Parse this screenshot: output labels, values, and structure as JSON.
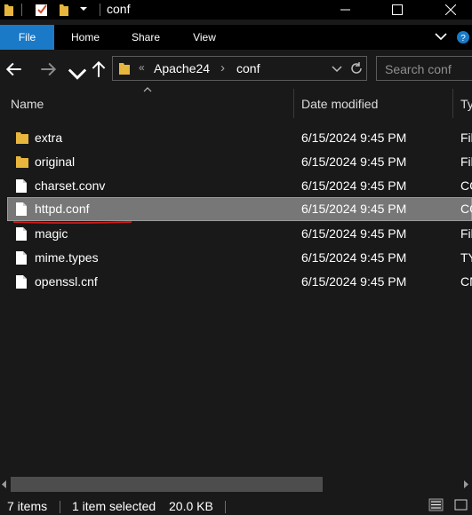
{
  "window": {
    "title": "conf",
    "controls": {
      "minimize": "minimize",
      "maximize": "maximize",
      "close": "close"
    }
  },
  "ribbon": {
    "tabs": [
      "File",
      "Home",
      "Share",
      "View"
    ],
    "accent": "#1a7ac7"
  },
  "address": {
    "overflow_glyph": "«",
    "crumbs": [
      "Apache24",
      "conf"
    ],
    "separator": "›"
  },
  "search": {
    "placeholder": "Search conf"
  },
  "columns": {
    "name": "Name",
    "date": "Date modified",
    "type": "Ty"
  },
  "files": [
    {
      "icon": "folder-icon",
      "name": "extra",
      "date": "6/15/2024 9:45 PM",
      "type": "Fil",
      "selected": false
    },
    {
      "icon": "folder-icon",
      "name": "original",
      "date": "6/15/2024 9:45 PM",
      "type": "Fil",
      "selected": false
    },
    {
      "icon": "file-icon",
      "name": "charset.conv",
      "date": "6/15/2024 9:45 PM",
      "type": "CC",
      "selected": false
    },
    {
      "icon": "file-icon",
      "name": "httpd.conf",
      "date": "6/15/2024 9:45 PM",
      "type": "CC",
      "selected": true
    },
    {
      "icon": "file-icon",
      "name": "magic",
      "date": "6/15/2024 9:45 PM",
      "type": "Fil",
      "selected": false
    },
    {
      "icon": "file-icon",
      "name": "mime.types",
      "date": "6/15/2024 9:45 PM",
      "type": "TY",
      "selected": false
    },
    {
      "icon": "file-icon",
      "name": "openssl.cnf",
      "date": "6/15/2024 9:45 PM",
      "type": "CN",
      "selected": false
    }
  ],
  "status": {
    "items_count": "7 items",
    "selection": "1 item selected",
    "size": "20.0 KB"
  },
  "colors": {
    "background": "#191919",
    "selected_row": "#777777",
    "annotation_underline": "#d11a1a"
  }
}
